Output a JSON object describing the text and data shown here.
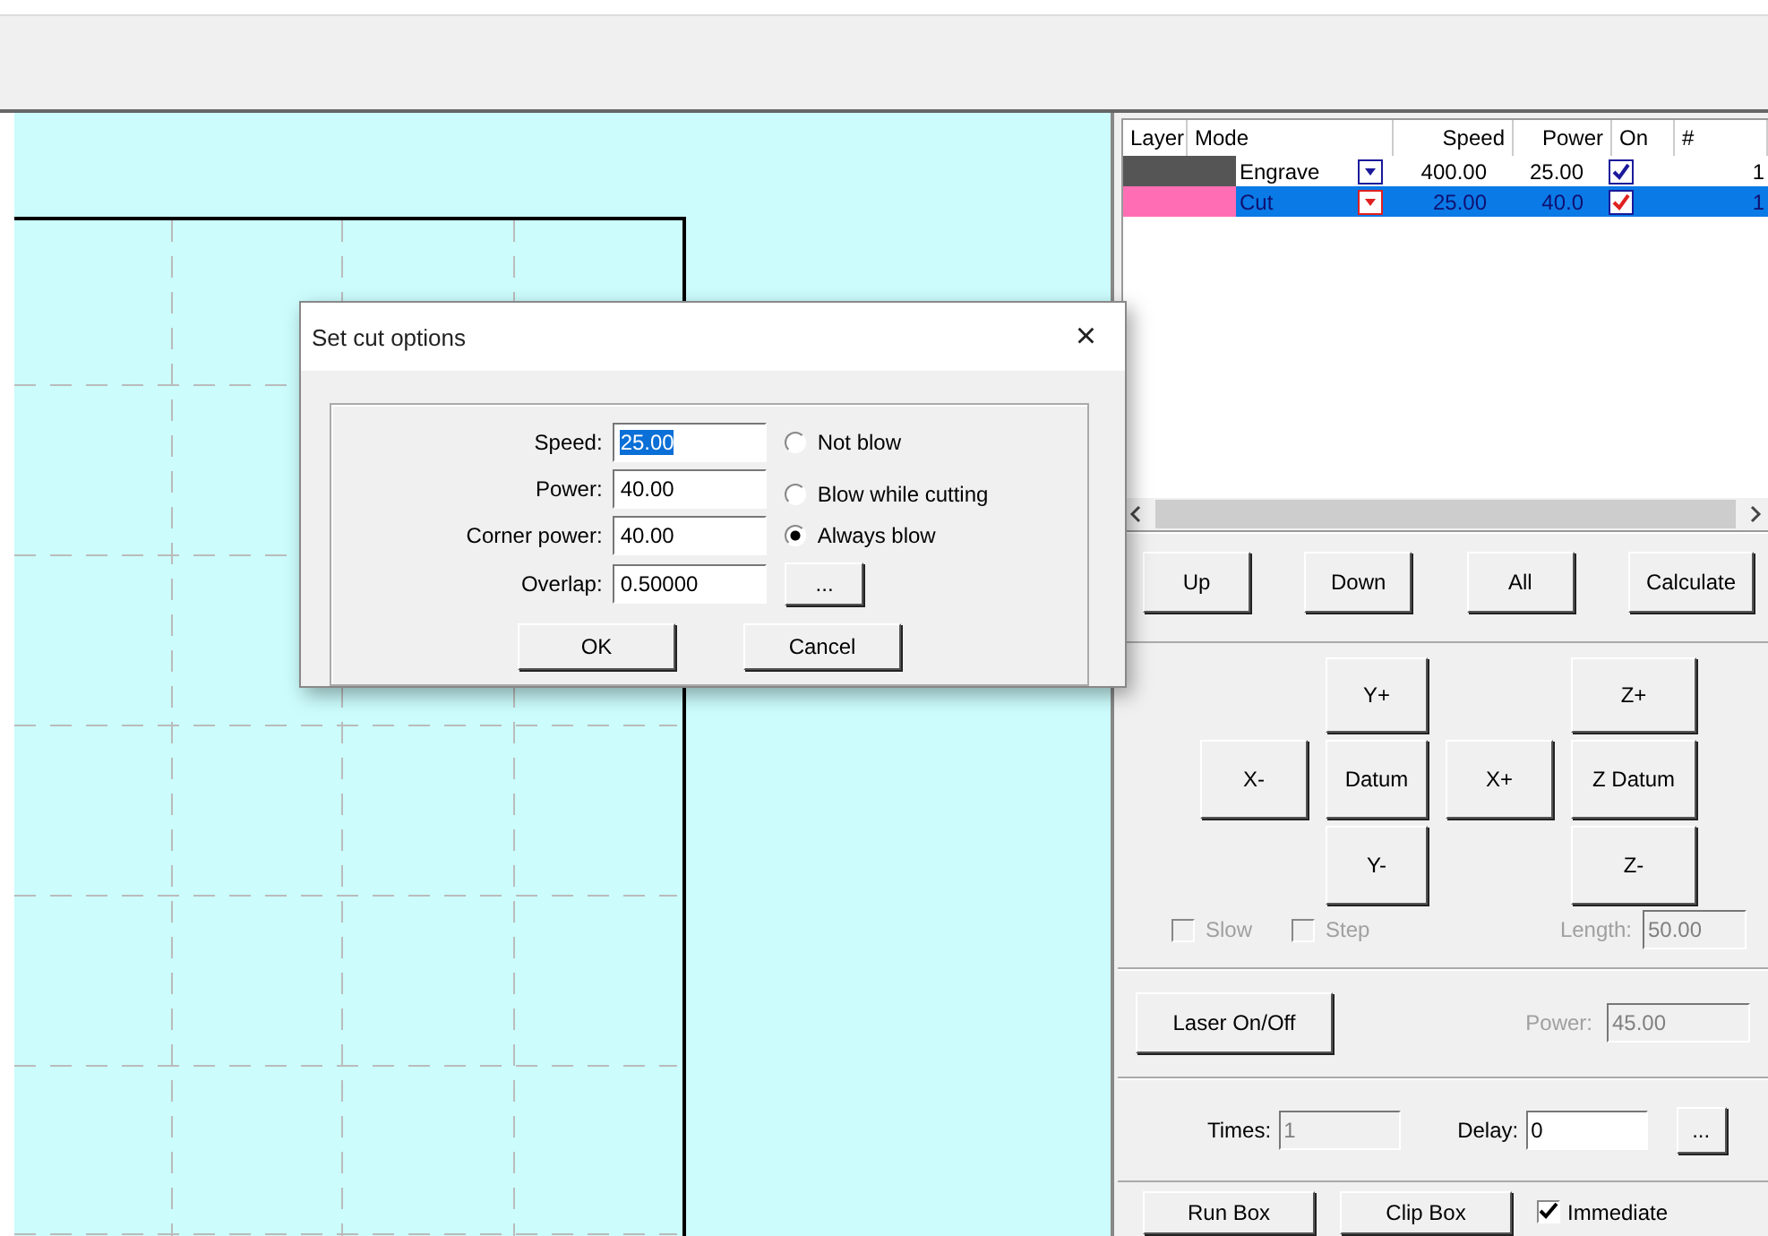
{
  "layers": {
    "columns": [
      "Layer",
      "Mode",
      "Speed",
      "Power",
      "On",
      "#"
    ],
    "rows": [
      {
        "color": "#555555",
        "mode": "Engrave",
        "speed": "400.00",
        "power": "25.00",
        "on": true,
        "count": "1",
        "selected": false
      },
      {
        "color": "#ff6eb4",
        "mode": "Cut",
        "speed": "25.00",
        "power": "40.0",
        "on": true,
        "count": "1",
        "selected": true
      }
    ]
  },
  "layer_buttons": [
    "Up",
    "Down",
    "All",
    "Calculate"
  ],
  "jog": {
    "y_plus": "Y+",
    "z_plus": "Z+",
    "x_minus": "X-",
    "datum": "Datum",
    "x_plus": "X+",
    "z_datum": "Z Datum",
    "y_minus": "Y-",
    "z_minus": "Z-"
  },
  "slow": {
    "label": "Slow",
    "checked": false,
    "disabled": true
  },
  "step": {
    "label": "Step",
    "checked": false,
    "disabled": true
  },
  "length": {
    "label": "Length:",
    "value": "50.00",
    "disabled": true
  },
  "laser_button": "Laser On/Off",
  "laser_power": {
    "label": "Power:",
    "value": "45.00",
    "disabled": true
  },
  "times": {
    "label": "Times:",
    "value": "1",
    "disabled": true
  },
  "delay": {
    "label": "Delay:",
    "value": "0",
    "disabled": false
  },
  "delay_button": "...",
  "run_box": "Run Box",
  "clip_box": "Clip Box",
  "immediate": {
    "label": "Immediate",
    "checked": true
  },
  "dialog": {
    "title": "Set cut options",
    "close": "×",
    "fields": [
      {
        "label": "Speed:",
        "value": "25.00",
        "highlighted": true
      },
      {
        "label": "Power:",
        "value": "40.00",
        "highlighted": false
      },
      {
        "label": "Corner power:",
        "value": "40.00",
        "highlighted": false
      },
      {
        "label": "Overlap:",
        "value": "0.50000",
        "highlighted": false
      }
    ],
    "blow_options": [
      {
        "label": "Not blow",
        "selected": false
      },
      {
        "label": "Blow while cutting",
        "selected": false
      },
      {
        "label": "Always blow",
        "selected": true
      }
    ],
    "overlap_button": "...",
    "buttons": [
      "OK",
      "Cancel"
    ]
  }
}
